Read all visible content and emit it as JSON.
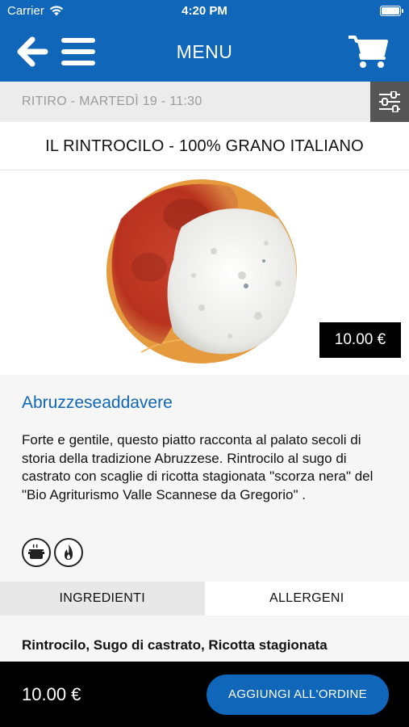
{
  "status_bar": {
    "carrier": "Carrier",
    "time": "4:20 PM",
    "icons": [
      "wifi-icon",
      "battery-icon"
    ]
  },
  "header": {
    "title": "MENU",
    "icons": [
      "back-arrow-icon",
      "hamburger-menu-icon",
      "cart-icon"
    ],
    "background_color": "#1066b8"
  },
  "pickup": {
    "text": "RITIRO - MARTEDÌ 19 - 11:30",
    "filter_icon": "sliders-icon"
  },
  "category": {
    "title": "IL RINTROCILO - 100% GRANO ITALIANO"
  },
  "dish": {
    "image_icon": "pasta-dish-image",
    "price": "10.00 €",
    "name": "Abruzzeseaddavere",
    "description": "Forte e gentile, questo piatto racconta al palato secoli di storia della tradizione Abruzzese. Rintrocilo al sugo di castrato con scaglie di ricotta stagionata \"scorza nera\" del \"Bio Agriturismo Valle Scannese da Gregorio\" .",
    "badges": [
      "cooking-pot-icon",
      "flame-icon"
    ]
  },
  "tabs": [
    {
      "label": "INGREDIENTI",
      "active": true
    },
    {
      "label": "ALLERGENI",
      "active": false
    }
  ],
  "ingredients": {
    "text": "Rintrocilo, Sugo di castrato, Ricotta stagionata"
  },
  "footer": {
    "total": "10.00 €",
    "add_button_label": "AGGIUNGI ALL'ORDINE",
    "accent_color": "#1066b8"
  }
}
